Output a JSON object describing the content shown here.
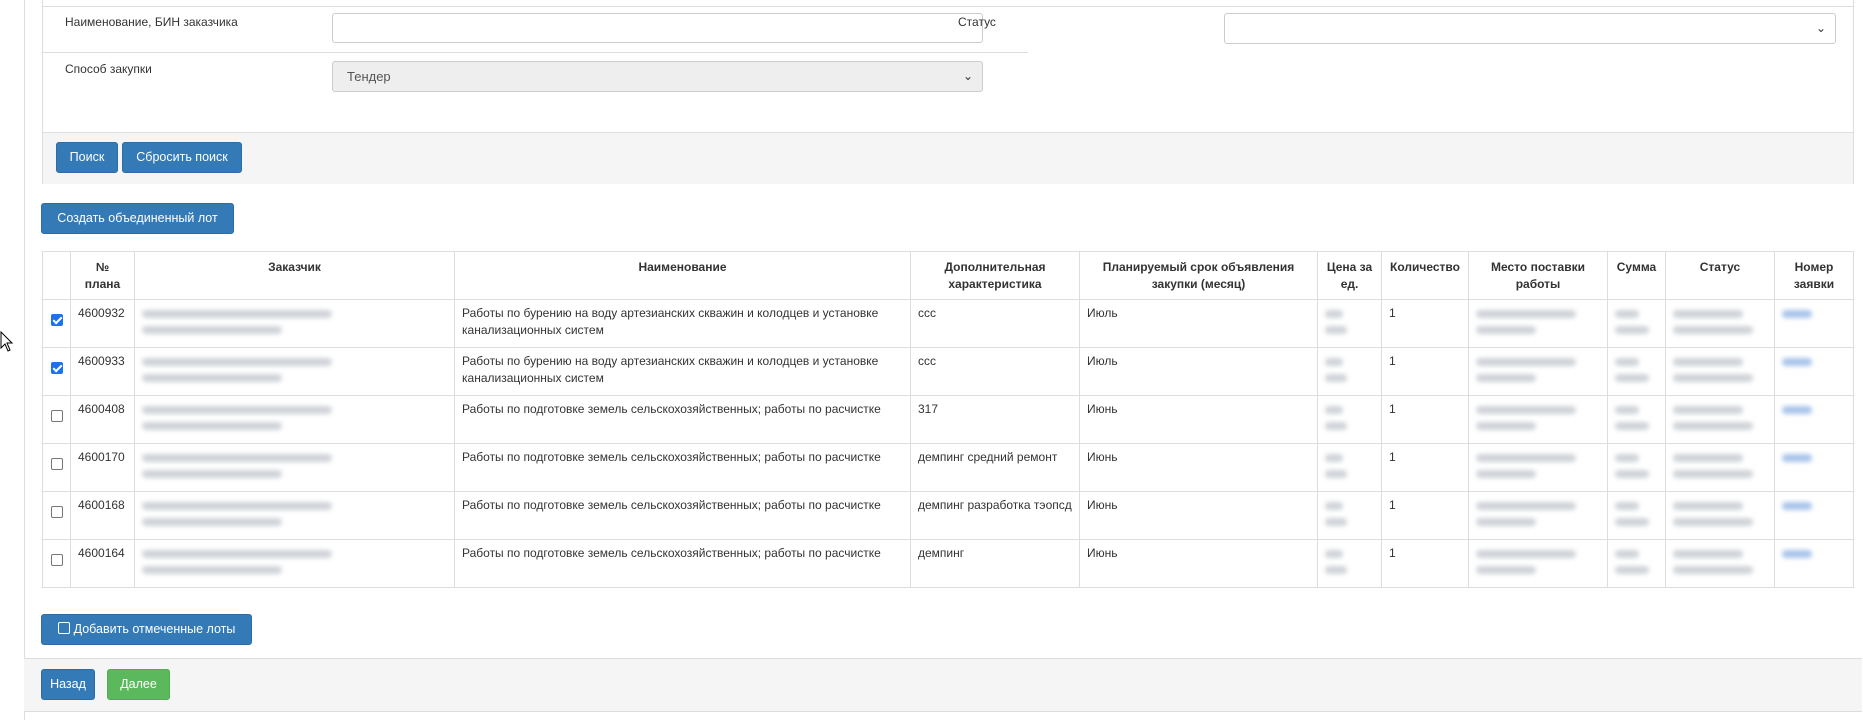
{
  "filters": {
    "customer_label": "Наименование, БИН заказчика",
    "customer_value": "",
    "status_label": "Статус",
    "status_value": "",
    "method_label": "Способ закупки",
    "method_value": "Тендер"
  },
  "buttons": {
    "search": "Поиск",
    "reset": "Сбросить поиск",
    "create_lot": "Создать объединенный лот",
    "add_marked": "Добавить отмеченные лоты",
    "back": "Назад",
    "next": "Далее"
  },
  "table": {
    "headers": [
      "№ плана",
      "Заказчик",
      "Наименование",
      "Дополнительная характеристика",
      "Планируемый срок объявления закупки (месяц)",
      "Цена за ед.",
      "Количество",
      "Место поставки работы",
      "Сумма",
      "Статус",
      "Номер заявки"
    ],
    "rows": [
      {
        "checked": true,
        "plan": "4600932",
        "name": "Работы по бурению на воду артезианских скважин и колодцев и установке канализационных систем",
        "extra": "ссс",
        "month": "Июль",
        "qty": "1"
      },
      {
        "checked": true,
        "plan": "4600933",
        "name": "Работы по бурению на воду артезианских скважин и колодцев и установке канализационных систем",
        "extra": "ссс",
        "month": "Июль",
        "qty": "1"
      },
      {
        "checked": false,
        "plan": "4600408",
        "name": "Работы по подготовке земель сельскохозяйственных; работы по расчистке",
        "extra": "317",
        "month": "Июнь",
        "qty": "1"
      },
      {
        "checked": false,
        "plan": "4600170",
        "name": "Работы по подготовке земель сельскохозяйственных; работы по расчистке",
        "extra": "демпинг средний ремонт",
        "month": "Июнь",
        "qty": "1"
      },
      {
        "checked": false,
        "plan": "4600168",
        "name": "Работы по подготовке земель сельскохозяйственных; работы по расчистке",
        "extra": "демпинг разработка тэопсд",
        "month": "Июнь",
        "qty": "1"
      },
      {
        "checked": false,
        "plan": "4600164",
        "name": "Работы по подготовке земель сельскохозяйственных; работы по расчистке",
        "extra": "демпинг",
        "month": "Июнь",
        "qty": "1"
      }
    ]
  },
  "icons": {
    "add_marked": "check-square-icon",
    "select_chevron": "chevron-down-icon"
  },
  "colors": {
    "primary": "#337ab7",
    "success": "#5cb85c",
    "checkbox_checked": "#1a73e8"
  }
}
